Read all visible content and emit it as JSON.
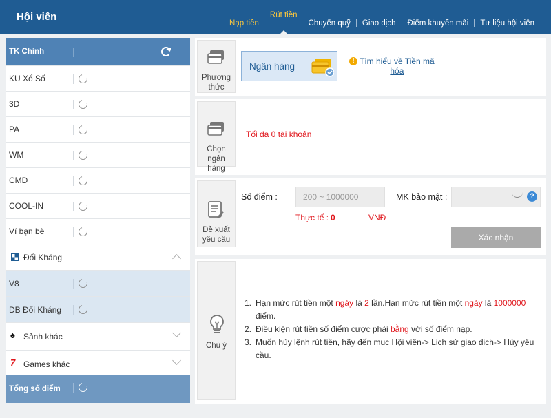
{
  "header": {
    "title": "Hội viên",
    "nav": [
      {
        "label": "Nạp tiền",
        "style": "yellow"
      },
      {
        "label": "Rút tiền",
        "style": "active"
      },
      {
        "label": "Chuyển quỹ",
        "style": ""
      },
      {
        "label": "Giao dịch",
        "style": ""
      },
      {
        "label": "Điểm khuyến mãi",
        "style": ""
      },
      {
        "label": "Tư liệu hội viên",
        "style": ""
      }
    ]
  },
  "sidebar": {
    "head": "TK Chính",
    "items": [
      "KU Xổ Số",
      "3D",
      "PA",
      "WM",
      "CMD",
      "COOL-IN",
      "Ví bạn bè"
    ],
    "group1": "Đối Kháng",
    "sub_items": [
      "V8",
      "DB Đối Kháng"
    ],
    "group2": "Sảnh khác",
    "group3": "Games khác",
    "foot": "Tổng số điểm"
  },
  "method": {
    "caption_1": "Phương",
    "caption_2": "thức",
    "bank_label": "Ngân hàng",
    "info_link_1": "Tìm hiểu về Tiền mã",
    "info_link_2": "hóa"
  },
  "bank": {
    "caption_1": "Chọn",
    "caption_2": "ngân hàng",
    "limit_text": "Tối đa 0 tài khoản"
  },
  "request": {
    "caption_1": "Đề xuất",
    "caption_2": "yêu cầu",
    "points_label": "Số điểm :",
    "points_placeholder": "200 ~ 1000000",
    "actual_label": "Thực tế :",
    "actual_value": "0",
    "currency": "VNĐ",
    "password_label": "MK bảo mật :",
    "confirm_label": "Xác nhận"
  },
  "notes": {
    "caption": "Chú ý",
    "n1_a": "Hạn mức rút tiền một ",
    "n1_b": "ngày",
    "n1_c": " là ",
    "n1_d": "2",
    "n1_e": " lần.Hạn mức rút tiền một ",
    "n1_f": "ngày",
    "n1_g": " là ",
    "n1_h": "1000000",
    "n1_i": " điểm.",
    "n2_a": "Điều kiện rút tiền số điểm cược phải ",
    "n2_b": "bằng",
    "n2_c": " với số điểm nạp.",
    "n3": "Muốn hủy lệnh rút tiền, hãy đến mục Hội viên-> Lịch sử giao dịch-> Hủy yêu cầu."
  },
  "colors": {
    "header_bg": "#1f5c93",
    "accent_yellow": "#ffc93c",
    "sidebar_head": "#4f82b5",
    "sub_bg": "#dbe7f2",
    "red": "#e0151b"
  }
}
